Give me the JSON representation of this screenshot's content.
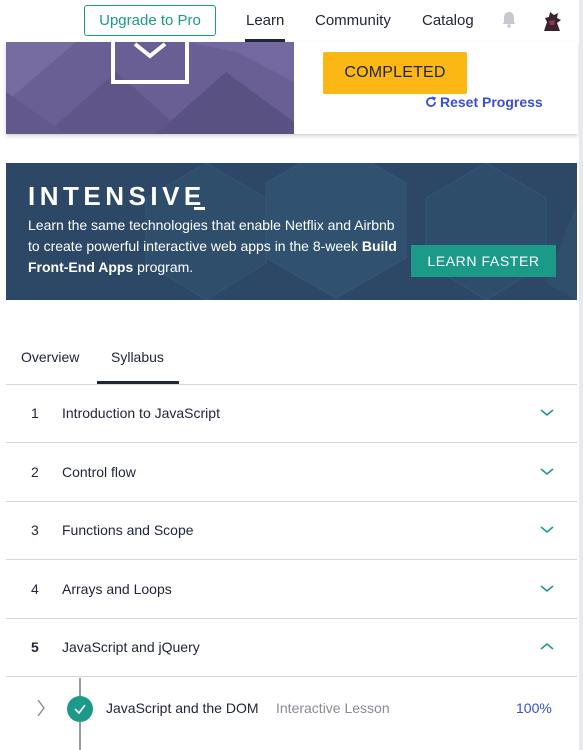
{
  "nav": {
    "upgrade_label": "Upgrade to Pro",
    "links": [
      "Learn",
      "Community",
      "Catalog"
    ],
    "active": "Learn",
    "bell_icon": "bell-icon",
    "avatar_icon": "user-avatar"
  },
  "course": {
    "status_label": "COMPLETED",
    "reset_label": "Reset Progress",
    "reset_icon": "refresh-icon",
    "banner_icon": "envelope-icon"
  },
  "intensive": {
    "title": "INTENSIVE",
    "text_before": "Learn the same technologies that enable Netflix and Airbnb to create powerful interactive web apps in the 8-week ",
    "text_bold": "Build Front-End Apps",
    "text_after": " program.",
    "button_label": "LEARN FASTER"
  },
  "tabs": {
    "overview": "Overview",
    "syllabus": "Syllabus",
    "active": "Syllabus"
  },
  "syllabus": {
    "units": [
      {
        "num": "1",
        "title": "Introduction to JavaScript",
        "expanded": false
      },
      {
        "num": "2",
        "title": "Control flow",
        "expanded": false
      },
      {
        "num": "3",
        "title": "Functions and Scope",
        "expanded": false
      },
      {
        "num": "4",
        "title": "Arrays and Loops",
        "expanded": false
      },
      {
        "num": "5",
        "title": "JavaScript and jQuery",
        "expanded": true
      }
    ],
    "lesson": {
      "title": "JavaScript and the DOM",
      "type": "Interactive Lesson",
      "progress": "100%",
      "completed": true
    }
  },
  "colors": {
    "accent_teal": "#1b9a8a",
    "completed_yellow": "#fbb714",
    "link_blue": "#3a4ed8",
    "banner_navy": "#2c4866",
    "course_purple": "#6a5f95"
  }
}
